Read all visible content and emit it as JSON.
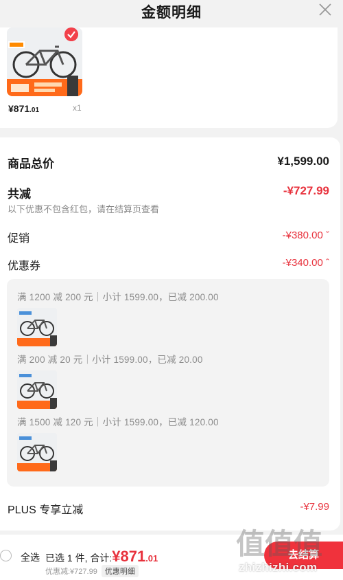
{
  "header": {
    "title": "金额明细"
  },
  "product": {
    "price_main": "¥871",
    "price_small": ".01",
    "qty": "x1"
  },
  "summary": {
    "total_label": "商品总价",
    "total_value": "¥1,599.00",
    "discount_label": "共减",
    "discount_value": "-¥727.99",
    "note": "以下优惠不包含红包，请在结算页查看",
    "promo_label": "促销",
    "promo_value": "-¥380.00 ˇ",
    "coupon_label": "优惠券",
    "coupon_value": "-¥340.00 ˆ",
    "plus_label": "PLUS 专享立减",
    "plus_value": "-¥7.99"
  },
  "coupons": [
    "满 1200 减 200 元｜小计 1599.00，已减 200.00",
    "满 200 减 20 元｜小计 1599.00，已减 20.00",
    "满 1500 减 120 元｜小计 1599.00，已减 120.00"
  ],
  "bottom": {
    "select_all": "全选",
    "selected": "已选 1 件, 合计:",
    "total_main": "¥871",
    "total_small": ".01",
    "discount_line": "优惠减:¥727.99",
    "detail_tag": "优惠明细",
    "checkout": "去结算"
  },
  "watermark": {
    "glyphs": "值值值",
    "url": "zhizhizhi.com"
  },
  "colors": {
    "accent_red": "#e8323d",
    "button_red": "#f0323c"
  }
}
